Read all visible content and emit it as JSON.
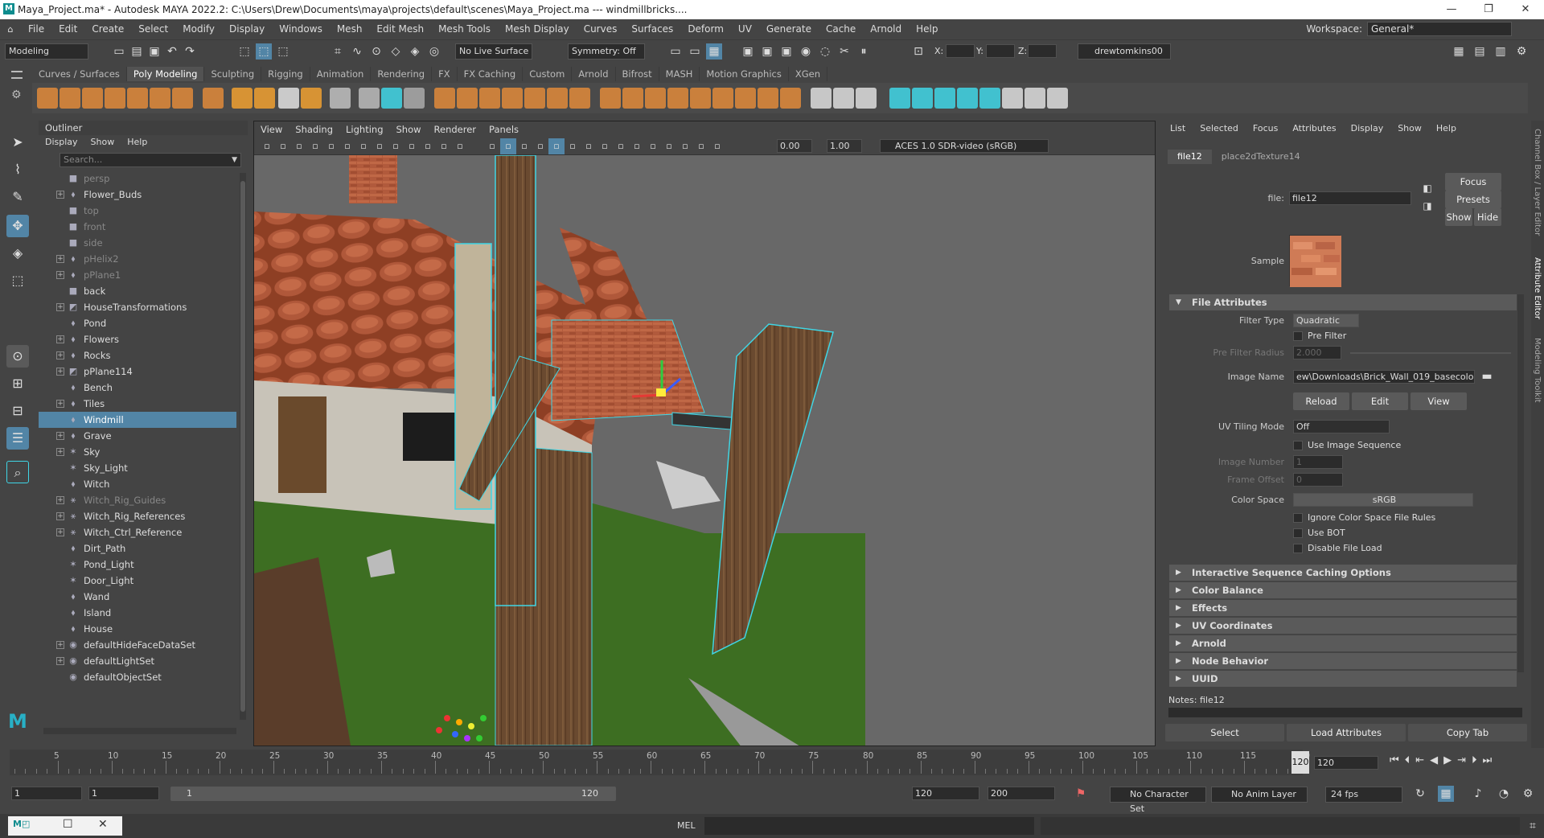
{
  "window": {
    "title": "Maya_Project.ma* - Autodesk MAYA 2022.2: C:\\Users\\Drew\\Documents\\maya\\projects\\default\\scenes\\Maya_Project.ma   ---   windmillbricks....",
    "controls": [
      "—",
      "❐",
      "✕"
    ]
  },
  "menubar": {
    "items": [
      "File",
      "Edit",
      "Create",
      "Select",
      "Modify",
      "Display",
      "Windows",
      "Mesh",
      "Edit Mesh",
      "Mesh Tools",
      "Mesh Display",
      "Curves",
      "Surfaces",
      "Deform",
      "UV",
      "Generate",
      "Cache",
      "Arnold",
      "Help"
    ],
    "workspace_label": "Workspace:",
    "workspace_value": "General*"
  },
  "statusline": {
    "mode": "Modeling",
    "live_surface": "No Live Surface",
    "symmetry": "Symmetry: Off",
    "x_label": "X:",
    "y_label": "Y:",
    "z_label": "Z:",
    "user": "drewtomkins00"
  },
  "shelf": {
    "tabs": [
      "Curves / Surfaces",
      "Poly Modeling",
      "Sculpting",
      "Rigging",
      "Animation",
      "Rendering",
      "FX",
      "FX Caching",
      "Custom",
      "Arnold",
      "Bifrost",
      "MASH",
      "Motion Graphics",
      "XGen"
    ],
    "active_tab": "Poly Modeling"
  },
  "outliner": {
    "title": "Outliner",
    "menu": [
      "Display",
      "Show",
      "Help"
    ],
    "search_placeholder": "Search...",
    "items": [
      {
        "label": "persp",
        "dim": true,
        "expand": false,
        "icon": "camera"
      },
      {
        "label": "Flower_Buds",
        "dim": false,
        "expand": true,
        "icon": "transform"
      },
      {
        "label": "top",
        "dim": true,
        "expand": false,
        "icon": "camera"
      },
      {
        "label": "front",
        "dim": true,
        "expand": false,
        "icon": "camera"
      },
      {
        "label": "side",
        "dim": true,
        "expand": false,
        "icon": "camera"
      },
      {
        "label": "pHelix2",
        "dim": true,
        "expand": true,
        "icon": "transform"
      },
      {
        "label": "pPlane1",
        "dim": true,
        "expand": true,
        "icon": "transform"
      },
      {
        "label": "back",
        "dim": false,
        "expand": false,
        "icon": "camera"
      },
      {
        "label": "HouseTransformations",
        "dim": false,
        "expand": true,
        "icon": "mesh"
      },
      {
        "label": "Pond",
        "dim": false,
        "expand": false,
        "icon": "transform"
      },
      {
        "label": "Flowers",
        "dim": false,
        "expand": true,
        "icon": "transform"
      },
      {
        "label": "Rocks",
        "dim": false,
        "expand": true,
        "icon": "transform"
      },
      {
        "label": "pPlane114",
        "dim": false,
        "expand": true,
        "icon": "mesh"
      },
      {
        "label": "Bench",
        "dim": false,
        "expand": false,
        "icon": "transform"
      },
      {
        "label": "Tiles",
        "dim": false,
        "expand": true,
        "icon": "transform"
      },
      {
        "label": "Windmill",
        "dim": false,
        "expand": false,
        "icon": "transform",
        "selected": true
      },
      {
        "label": "Grave",
        "dim": false,
        "expand": true,
        "icon": "transform"
      },
      {
        "label": "Sky",
        "dim": false,
        "expand": true,
        "icon": "light"
      },
      {
        "label": "Sky_Light",
        "dim": false,
        "expand": false,
        "icon": "light"
      },
      {
        "label": "Witch",
        "dim": false,
        "expand": false,
        "icon": "transform"
      },
      {
        "label": "Witch_Rig_Guides",
        "dim": true,
        "expand": true,
        "icon": "joint"
      },
      {
        "label": "Witch_Rig_References",
        "dim": false,
        "expand": true,
        "icon": "joint"
      },
      {
        "label": "Witch_Ctrl_Reference",
        "dim": false,
        "expand": true,
        "icon": "joint"
      },
      {
        "label": "Dirt_Path",
        "dim": false,
        "expand": false,
        "icon": "transform"
      },
      {
        "label": "Pond_Light",
        "dim": false,
        "expand": false,
        "icon": "light"
      },
      {
        "label": "Door_Light",
        "dim": false,
        "expand": false,
        "icon": "light"
      },
      {
        "label": "Wand",
        "dim": false,
        "expand": false,
        "icon": "transform"
      },
      {
        "label": "Island",
        "dim": false,
        "expand": false,
        "icon": "transform"
      },
      {
        "label": "House",
        "dim": false,
        "expand": false,
        "icon": "transform"
      },
      {
        "label": "defaultHideFaceDataSet",
        "dim": false,
        "expand": true,
        "icon": "set"
      },
      {
        "label": "defaultLightSet",
        "dim": false,
        "expand": true,
        "icon": "set"
      },
      {
        "label": "defaultObjectSet",
        "dim": false,
        "expand": false,
        "icon": "set"
      }
    ]
  },
  "viewport": {
    "menu": [
      "View",
      "Shading",
      "Lighting",
      "Show",
      "Renderer",
      "Panels"
    ],
    "exposure": "0.00",
    "gamma": "1.00",
    "colorspace": "ACES 1.0 SDR-video (sRGB)"
  },
  "attribute_editor": {
    "menu": [
      "List",
      "Selected",
      "Focus",
      "Attributes",
      "Display",
      "Show",
      "Help"
    ],
    "tabs": [
      "file12",
      "place2dTexture14"
    ],
    "file_label": "file:",
    "file_value": "file12",
    "focus": "Focus",
    "presets": "Presets",
    "show": "Show",
    "hide": "Hide",
    "sample_label": "Sample",
    "section_file_attributes": "File Attributes",
    "filter_type_label": "Filter Type",
    "filter_type_value": "Quadratic",
    "pre_filter": "Pre Filter",
    "pre_filter_radius_label": "Pre Filter Radius",
    "pre_filter_radius_value": "2.000",
    "image_name_label": "Image Name",
    "image_name_value": "ew\\Downloads\\Brick_Wall_019_basecolor.jpg",
    "reload": "Reload",
    "edit": "Edit",
    "view": "View",
    "uv_tiling_label": "UV Tiling Mode",
    "uv_tiling_value": "Off",
    "use_image_sequence": "Use Image Sequence",
    "image_number_label": "Image Number",
    "image_number_value": "1",
    "frame_offset_label": "Frame Offset",
    "frame_offset_value": "0",
    "color_space_label": "Color Space",
    "color_space_value": "sRGB",
    "ignore_cs": "Ignore Color Space File Rules",
    "use_bot": "Use BOT",
    "disable_load": "Disable File Load",
    "sections": [
      "Interactive Sequence Caching Options",
      "Color Balance",
      "Effects",
      "UV Coordinates",
      "Arnold",
      "Node Behavior",
      "UUID"
    ],
    "notes": "Notes:  file12",
    "bottom_buttons": [
      "Select",
      "Load Attributes",
      "Copy Tab"
    ],
    "side_tabs": [
      "Channel Box / Layer Editor",
      "Attribute Editor",
      "Modeling Toolkit"
    ]
  },
  "timeline": {
    "ticks": [
      "5",
      "10",
      "15",
      "20",
      "25",
      "30",
      "35",
      "40",
      "45",
      "50",
      "55",
      "60",
      "65",
      "70",
      "75",
      "80",
      "85",
      "90",
      "95",
      "100",
      "105",
      "110",
      "115",
      "120"
    ],
    "current_frame": "120",
    "current_frame_field": "120"
  },
  "range": {
    "start": "1",
    "start2": "1",
    "slider_start": "1",
    "slider_end": "120",
    "end": "120",
    "end2": "200",
    "character_set": "No Character Set",
    "anim_layer": "No Anim Layer",
    "fps": "24 fps"
  },
  "command": {
    "mel": "MEL"
  },
  "colors": {
    "accent": "#5285a6",
    "wireframe": "#3fd6e6",
    "grass": "#3b6e1f",
    "roof": "#9a4a2c"
  }
}
